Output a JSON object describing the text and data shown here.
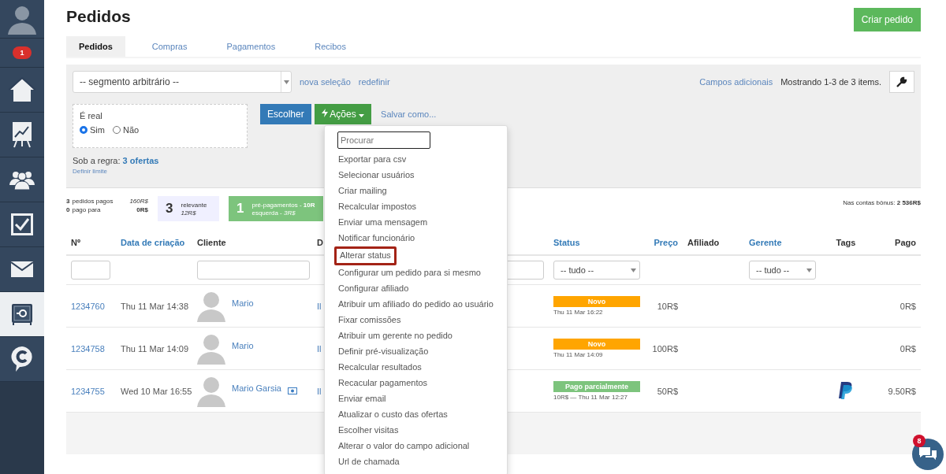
{
  "sidebar": {
    "badge": "1",
    "items": [
      {
        "kind": "home",
        "selected": false
      },
      {
        "kind": "chart",
        "selected": false
      },
      {
        "kind": "people",
        "selected": false
      },
      {
        "kind": "check",
        "selected": false
      },
      {
        "kind": "mail",
        "selected": false
      },
      {
        "kind": "safe",
        "selected": true
      },
      {
        "kind": "chat",
        "selected": false
      }
    ]
  },
  "title": "Pedidos",
  "create_button": "Criar pedido",
  "tabs": [
    {
      "label": "Pedidos",
      "selected": true
    },
    {
      "label": "Compras",
      "selected": false
    },
    {
      "label": "Pagamentos",
      "selected": false
    },
    {
      "label": "Recibos",
      "selected": false
    }
  ],
  "filter": {
    "segment": "-- segmento arbitrário --",
    "links": [
      "nova seleção",
      "redefinir"
    ],
    "extra_link": "Campos adicionais",
    "showing": "Mostrando 1-3 de 3 items.",
    "condition": {
      "label": "É real",
      "options": [
        {
          "label": "Sim",
          "selected": true
        },
        {
          "label": "Não",
          "selected": false
        }
      ]
    },
    "buttons": {
      "choose": "Escolher",
      "actions": "Ações",
      "save": "Salvar como..."
    },
    "rule": "Sob a regra: **3 ofertas**",
    "limit": "Definir limite"
  },
  "stats": {
    "lines": [
      {
        "count": "3",
        "label": "pedidos pagos",
        "amount": "160R$",
        "italic": true
      },
      {
        "count": "0",
        "label": "pago para",
        "amount": "0R$",
        "italic": false
      }
    ],
    "relevant": {
      "count": "3",
      "label": "relevante",
      "amount": "12R$"
    },
    "prepay": {
      "count": "1",
      "line1": "pré-pagamentos - **10R**",
      "line2": "esquerda - *3R$*"
    },
    "bonus": "Nas contas bônus: **2 536R$**"
  },
  "table": {
    "columns": [
      {
        "label": "Nº",
        "link": false
      },
      {
        "label": "Data de criação",
        "link": true
      },
      {
        "label": "Cliente",
        "link": false
      },
      {
        "label": "D",
        "link": false
      },
      {
        "label": "Status",
        "link": true
      },
      {
        "label": "Preço",
        "link": true
      },
      {
        "label": "Afiliado",
        "link": false
      },
      {
        "label": "Gerente",
        "link": true
      },
      {
        "label": "Tags",
        "link": false
      },
      {
        "label": "Pago",
        "link": false
      }
    ],
    "status_filter": "-- tudo --",
    "manager_filter": "-- tudo --",
    "rows": [
      {
        "id": "1234760",
        "date": "Thu 11 Mar 14:38",
        "client": "Mario",
        "id_icon": false,
        "column_4": "Il",
        "status": "Novo",
        "color": "#ffa500",
        "status_date": "Thu 11 Mar 16:22",
        "price": "10R$",
        "payment_icon": false,
        "paid": "0R$"
      },
      {
        "id": "1234758",
        "date": "Thu 11 Mar 14:09",
        "client": "Mario",
        "id_icon": false,
        "column_4": "Il",
        "status": "Novo",
        "color": "#ffa500",
        "status_date": "Thu 11 Mar 14:09",
        "price": "100R$",
        "payment_icon": false,
        "paid": "0R$"
      },
      {
        "id": "1234755",
        "date": "Wed 10 Mar 16:55",
        "client": "Mario Garsia",
        "id_icon": true,
        "column_4": "Il",
        "status": "Pago parcialmente",
        "color": "#7dc47d",
        "status_date": "10R$ — Thu 11 Mar 12:27",
        "price": "50R$",
        "payment_icon": true,
        "paid": "9.50R$"
      }
    ]
  },
  "menu": {
    "search_placeholder": "Procurar",
    "items": [
      {
        "label": "Exportar para csv",
        "highlighted": false
      },
      {
        "label": "Selecionar usuários",
        "highlighted": false
      },
      {
        "label": "Criar mailing",
        "highlighted": false
      },
      {
        "label": "Recalcular impostos",
        "highlighted": false
      },
      {
        "label": "Enviar uma mensagem",
        "highlighted": false
      },
      {
        "label": "Notificar funcionário",
        "highlighted": false
      },
      {
        "label": "Alterar status",
        "highlighted": true
      },
      {
        "label": "Configurar um pedido para si mesmo",
        "highlighted": false
      },
      {
        "label": "Configurar afiliado",
        "highlighted": false
      },
      {
        "label": "Atribuir um afiliado do pedido ao usuário",
        "highlighted": false
      },
      {
        "label": "Fixar comissões",
        "highlighted": false
      },
      {
        "label": "Atribuir um gerente no pedido",
        "highlighted": false
      },
      {
        "label": "Definir pré-visualização",
        "highlighted": false
      },
      {
        "label": "Recalcular resultados",
        "highlighted": false
      },
      {
        "label": "Recacular pagamentos",
        "highlighted": false
      },
      {
        "label": "Enviar email",
        "highlighted": false
      },
      {
        "label": "Atualizar o custo das ofertas",
        "highlighted": false
      },
      {
        "label": "Escolher visitas",
        "highlighted": false
      },
      {
        "label": "Alterar o valor do campo adicional",
        "highlighted": false
      },
      {
        "label": "Url de chamada",
        "highlighted": false
      }
    ]
  },
  "chat": {
    "badge": "8"
  }
}
